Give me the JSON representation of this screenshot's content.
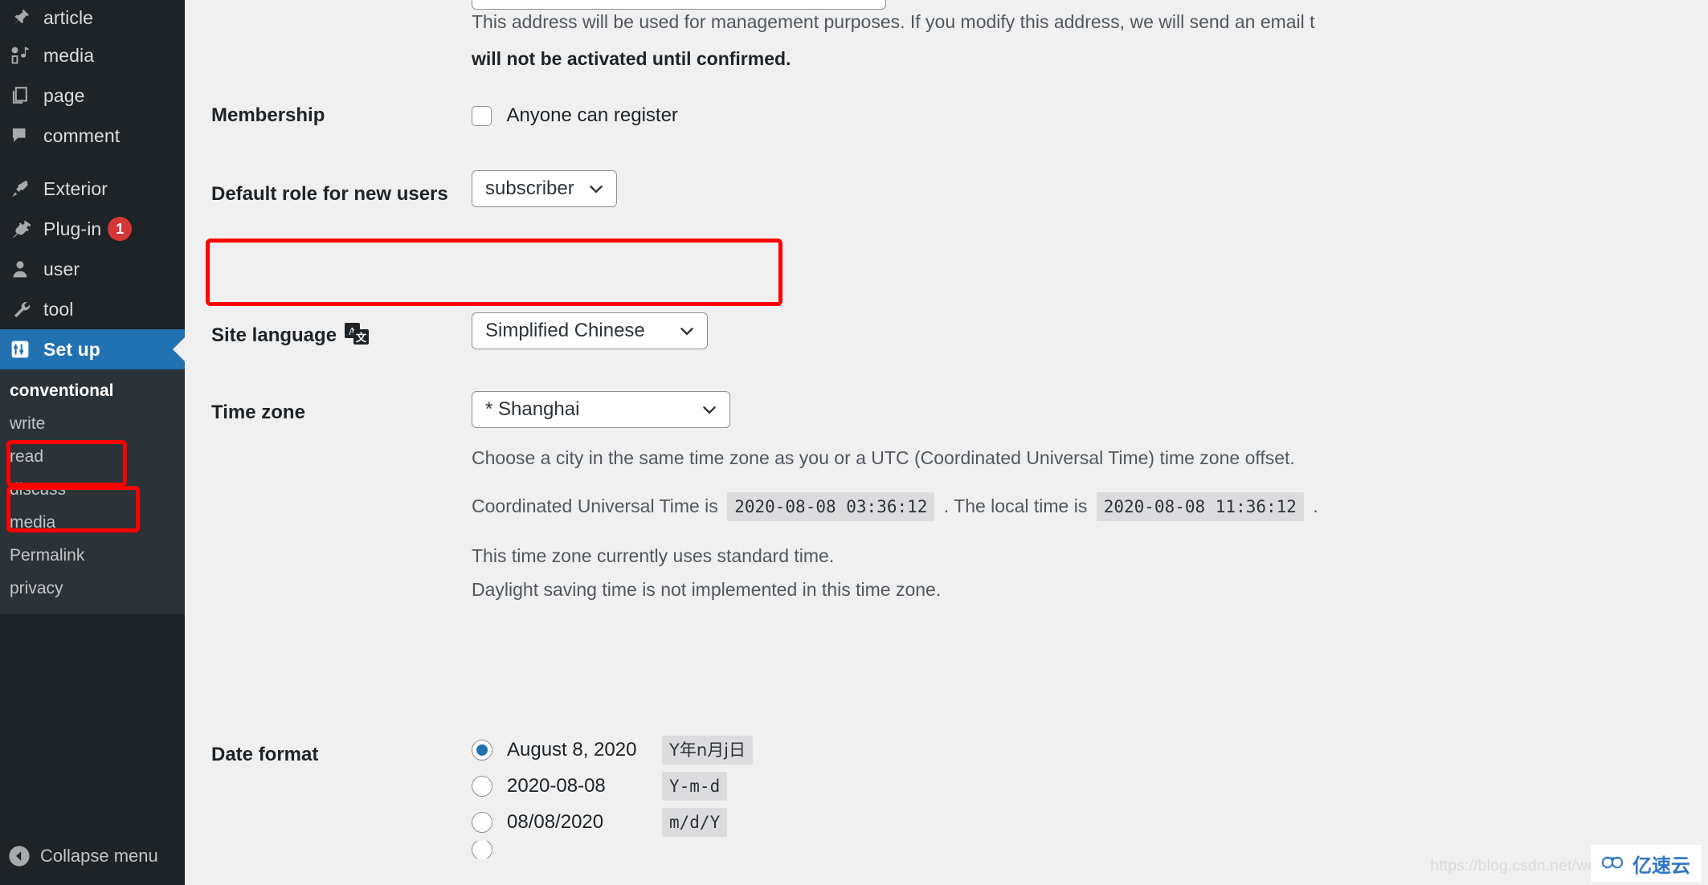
{
  "sidebar": {
    "items": [
      {
        "label": "article",
        "icon": "pin-icon",
        "badge": null
      },
      {
        "label": "media",
        "icon": "media-icon",
        "badge": null
      },
      {
        "label": "page",
        "icon": "pages-icon",
        "badge": null
      },
      {
        "label": "comment",
        "icon": "comment-icon",
        "badge": null
      },
      {
        "label": "Exterior",
        "icon": "brush-icon",
        "badge": null
      },
      {
        "label": "Plug-in",
        "icon": "plugin-icon",
        "badge": "1"
      },
      {
        "label": "user",
        "icon": "user-icon",
        "badge": null
      },
      {
        "label": "tool",
        "icon": "wrench-icon",
        "badge": null
      }
    ],
    "current": {
      "label": "Set up",
      "icon": "settings-icon"
    },
    "submenu": [
      {
        "label": "conventional",
        "active": true
      },
      {
        "label": "write",
        "active": false
      },
      {
        "label": "read",
        "active": false
      },
      {
        "label": "discuss",
        "active": false
      },
      {
        "label": "media",
        "active": false
      },
      {
        "label": "Permalink",
        "active": false
      },
      {
        "label": "privacy",
        "active": false
      }
    ],
    "collapse_label": "Collapse menu",
    "accent_color": "#2271b1",
    "background_color": "#1d2327",
    "submenu_background": "#2c3338",
    "badge_color": "#d63638"
  },
  "main": {
    "email_desc_line1": "This address will be used for management purposes. If you modify this address, we will send an email t",
    "email_desc_line2_bold": "will not be activated until confirmed.",
    "membership": {
      "label": "Membership",
      "checkbox_label": "Anyone can register",
      "checked": false
    },
    "default_role": {
      "label": "Default role for new users",
      "value": "subscriber"
    },
    "site_language": {
      "label": "Site language",
      "icon": "translate-icon",
      "value": "Simplified Chinese"
    },
    "timezone": {
      "label": "Time zone",
      "value": "* Shanghai",
      "help": "Choose a city in the same time zone as you or a UTC (Coordinated Universal Time) time zone offset.",
      "utc_prefix": "Coordinated Universal Time is",
      "utc_value": "2020-08-08 03:36:12",
      "utc_sep": ". The local time is",
      "local_value": "2020-08-08 11:36:12",
      "utc_suffix": ".",
      "standard_time_note": "This time zone currently uses standard time.",
      "dst_note": "Daylight saving time is not implemented in this time zone."
    },
    "date_format": {
      "label": "Date format",
      "options": [
        {
          "preview": "August 8, 2020",
          "code": "Y年n月j日",
          "checked": true,
          "cjk": true
        },
        {
          "preview": "2020-08-08",
          "code": "Y-m-d",
          "checked": false,
          "cjk": false
        },
        {
          "preview": "08/08/2020",
          "code": "m/d/Y",
          "checked": false,
          "cjk": false
        }
      ]
    }
  },
  "watermark": {
    "url": "https://blog.csdn.net/weixi",
    "badge_text": "亿速云",
    "badge_icon": "cloud-icon"
  }
}
